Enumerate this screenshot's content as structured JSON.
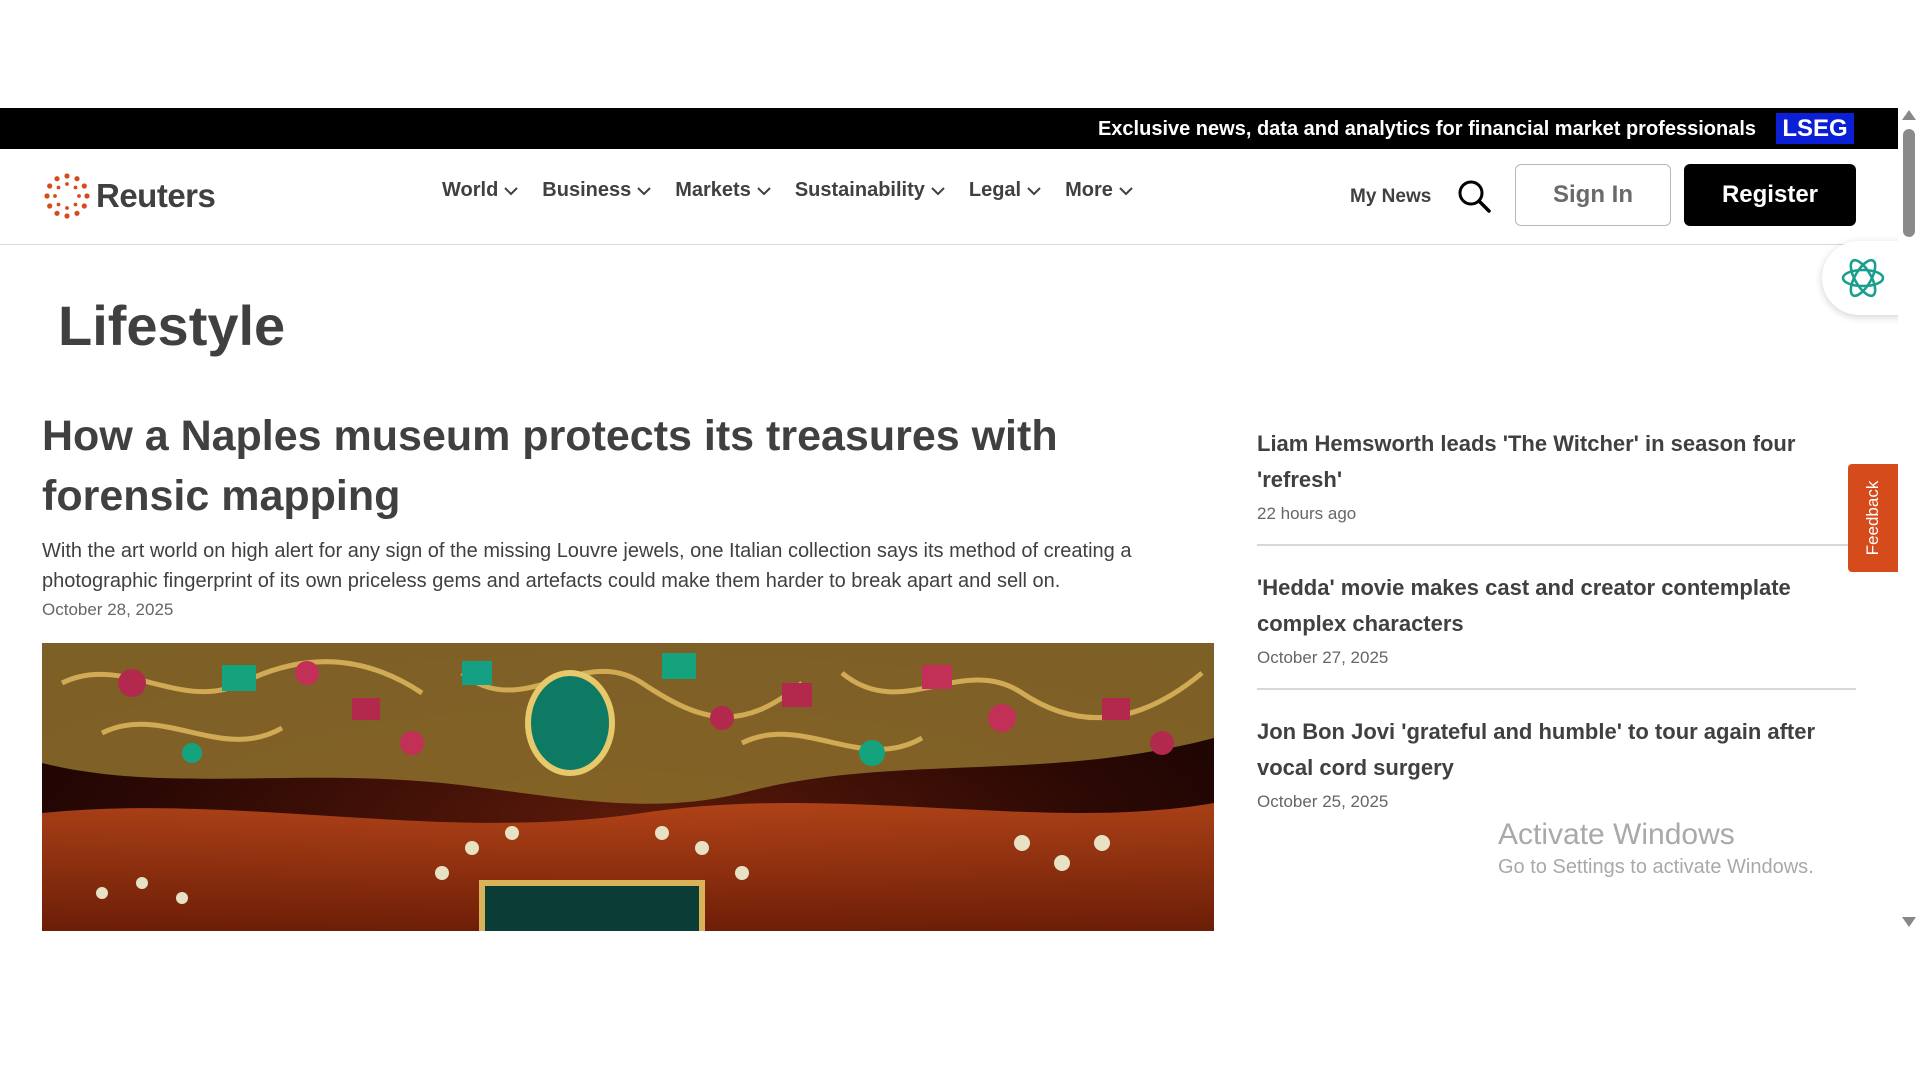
{
  "promo": {
    "text": "Exclusive news, data and analytics for financial market professionals",
    "badge": "LSEG"
  },
  "header": {
    "logo_text": "Reuters",
    "nav": [
      "World",
      "Business",
      "Markets",
      "Sustainability",
      "Legal",
      "More"
    ],
    "my_news": "My News",
    "sign_in": "Sign In",
    "register": "Register"
  },
  "section_title": "Lifestyle",
  "lead": {
    "headline": "How a Naples museum protects its treasures with forensic mapping",
    "summary": "With the art world on high alert for any sign of the missing Louvre jewels, one Italian collection says its method of creating a photographic fingerprint of its own priceless gems and artefacts could make them harder to break apart and sell on.",
    "date": "October 28, 2025"
  },
  "side_stories": [
    {
      "headline": "Liam Hemsworth leads 'The Witcher' in season four 'refresh'",
      "date": "22 hours ago"
    },
    {
      "headline": "'Hedda' movie makes cast and creator contemplate complex characters",
      "date": "October 27, 2025"
    },
    {
      "headline": "Jon Bon Jovi 'grateful and humble' to tour again after vocal cord surgery",
      "date": "October 25, 2025"
    }
  ],
  "feedback": "Feedback",
  "activation": {
    "title": "Activate Windows",
    "subtitle": "Go to Settings to activate Windows."
  },
  "colors": {
    "brand_orange": "#d64b1c",
    "lseg_blue": "#0a1fd6",
    "ai_green": "#1a9e8f"
  }
}
